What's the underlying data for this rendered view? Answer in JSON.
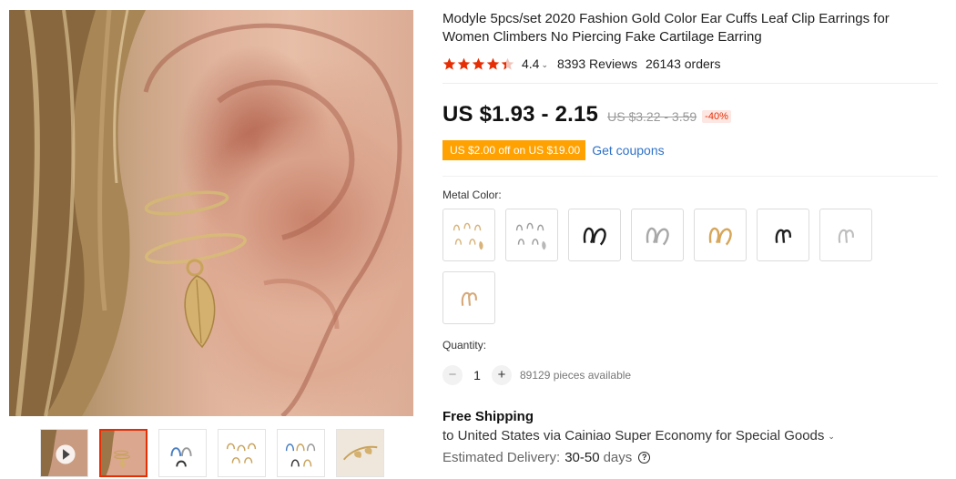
{
  "product": {
    "title": "Modyle 5pcs/set 2020 Fashion Gold Color Ear Cuffs Leaf Clip Earrings for Women Climbers No Piercing Fake Cartilage Earring",
    "rating": "4.4",
    "rating_value": 4.4,
    "rating_max": 5,
    "reviews": "8393 Reviews",
    "orders": "26143 orders"
  },
  "price": {
    "current": "US $1.93 - 2.15",
    "original": "US $3.22 - 3.59",
    "discount": "-40%"
  },
  "coupon": {
    "tag": "US $2.00 off on US $19.00",
    "link": "Get coupons"
  },
  "variants": {
    "label": "Metal Color:",
    "options": [
      {
        "name": "set-gold",
        "color": "#d8b37a"
      },
      {
        "name": "set-silver",
        "color": "#b8b8b8"
      },
      {
        "name": "black",
        "color": "#1c1c1c"
      },
      {
        "name": "silver",
        "color": "#aaaaaa"
      },
      {
        "name": "gold",
        "color": "#d7a65a"
      },
      {
        "name": "black-2",
        "color": "#222222"
      },
      {
        "name": "silver-2",
        "color": "#bdbdbd"
      },
      {
        "name": "rose-gold",
        "color": "#d6a878"
      }
    ]
  },
  "quantity": {
    "label": "Quantity:",
    "minus": "−",
    "value": "1",
    "plus": "+",
    "available": "89129 pieces available"
  },
  "shipping": {
    "title": "Free Shipping",
    "destination": "to United States via Cainiao Super Economy for Special Goods",
    "estimated_label": "Estimated Delivery:",
    "estimated_days": "30-50",
    "days_unit": "days",
    "help": "?"
  },
  "colors": {
    "star": "#e62e04",
    "coupon_bg": "#ffa100",
    "link": "#2e72c8",
    "active_thumb": "#e62e04"
  }
}
